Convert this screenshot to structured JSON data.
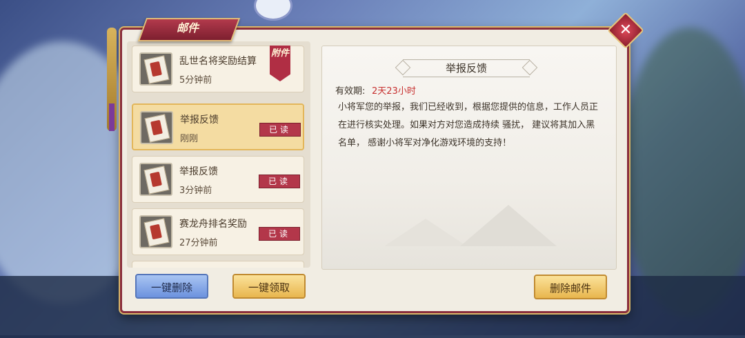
{
  "window": {
    "title": "邮件",
    "close_icon": "close-icon"
  },
  "mail_list": [
    {
      "title": "乱世名将奖励结算",
      "time": "5分钟前",
      "badge": "",
      "attachment": "附件",
      "selected": false
    },
    {
      "title": "举报反馈",
      "time": "刚刚",
      "badge": "已读",
      "attachment": "",
      "selected": true
    },
    {
      "title": "举报反馈",
      "time": "3分钟前",
      "badge": "已读",
      "attachment": "",
      "selected": false
    },
    {
      "title": "赛龙舟排名奖励",
      "time": "27分钟前",
      "badge": "已读",
      "attachment": "",
      "selected": false
    }
  ],
  "buttons": {
    "delete_all": "一键删除",
    "claim_all": "一键领取",
    "delete_mail": "删除邮件"
  },
  "detail": {
    "title": "举报反馈",
    "validity_label": "有效期:",
    "validity_value": "2天23小时",
    "body": "小将军您的举报，我们已经收到，根据您提供的信息，工作人员正在进行核实处理。如果对方对您造成持续 骚扰， 建议将其加入黑名单， 感谢小将军对净化游戏环境的支持！"
  },
  "colors": {
    "frame": "#8a2e3c",
    "accent_red": "#b3374a",
    "gold": "#e8b64e",
    "validity": "#c7302f"
  }
}
